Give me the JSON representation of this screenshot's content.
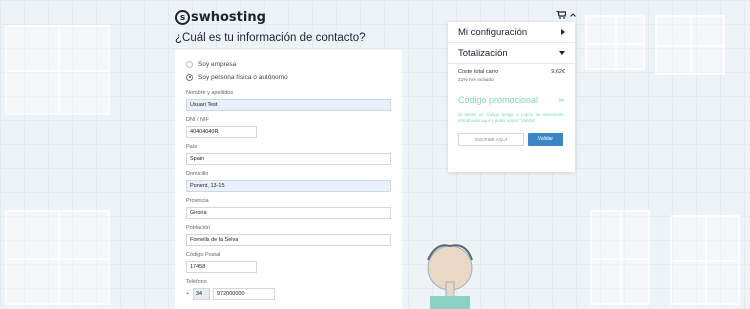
{
  "header": {
    "logo_text": "swhosting",
    "cart_icon": "shopping-cart-icon"
  },
  "contact": {
    "title": "¿Cuál es tu información de contacto?",
    "options": [
      {
        "label": "Soy empresa",
        "checked": false
      },
      {
        "label": "Soy persona física o autónomo",
        "checked": true
      }
    ],
    "fields": {
      "name": {
        "label": "Nombre y apellidos",
        "value": "Usuari Test"
      },
      "dni": {
        "label": "DNI / NIF",
        "value": "40404040R"
      },
      "country": {
        "label": "País",
        "value": "Spain"
      },
      "address": {
        "label": "Domicilio",
        "value": "Ponent, 13-15"
      },
      "province": {
        "label": "Provincia",
        "value": "Girona"
      },
      "city": {
        "label": "Población",
        "value": "Fornells de la Selva"
      },
      "postal": {
        "label": "Código Postal",
        "value": "17458"
      },
      "phone": {
        "label": "Teléfono",
        "prefix_sign": "+",
        "prefix": "34",
        "value": "972000000"
      }
    }
  },
  "summary": {
    "config_title": "Mi configuración",
    "total_title": "Totalización",
    "cost_label": "Coste total carro",
    "cost_value": "9,62€",
    "iva_note": "21% IVA incluido",
    "promo_title": "Código promocional",
    "promo_text": "Si tienes un código amigo o cupón de descuento, introdúcelo aquí y pulsa sobre \"Validar\".",
    "promo_placeholder": "ESCRIBE AQUÍ",
    "validate_label": "Validar"
  },
  "colors": {
    "accent": "#3b86c6",
    "promo": "#7fd7b9",
    "filled_input": "#e7f0fb"
  }
}
